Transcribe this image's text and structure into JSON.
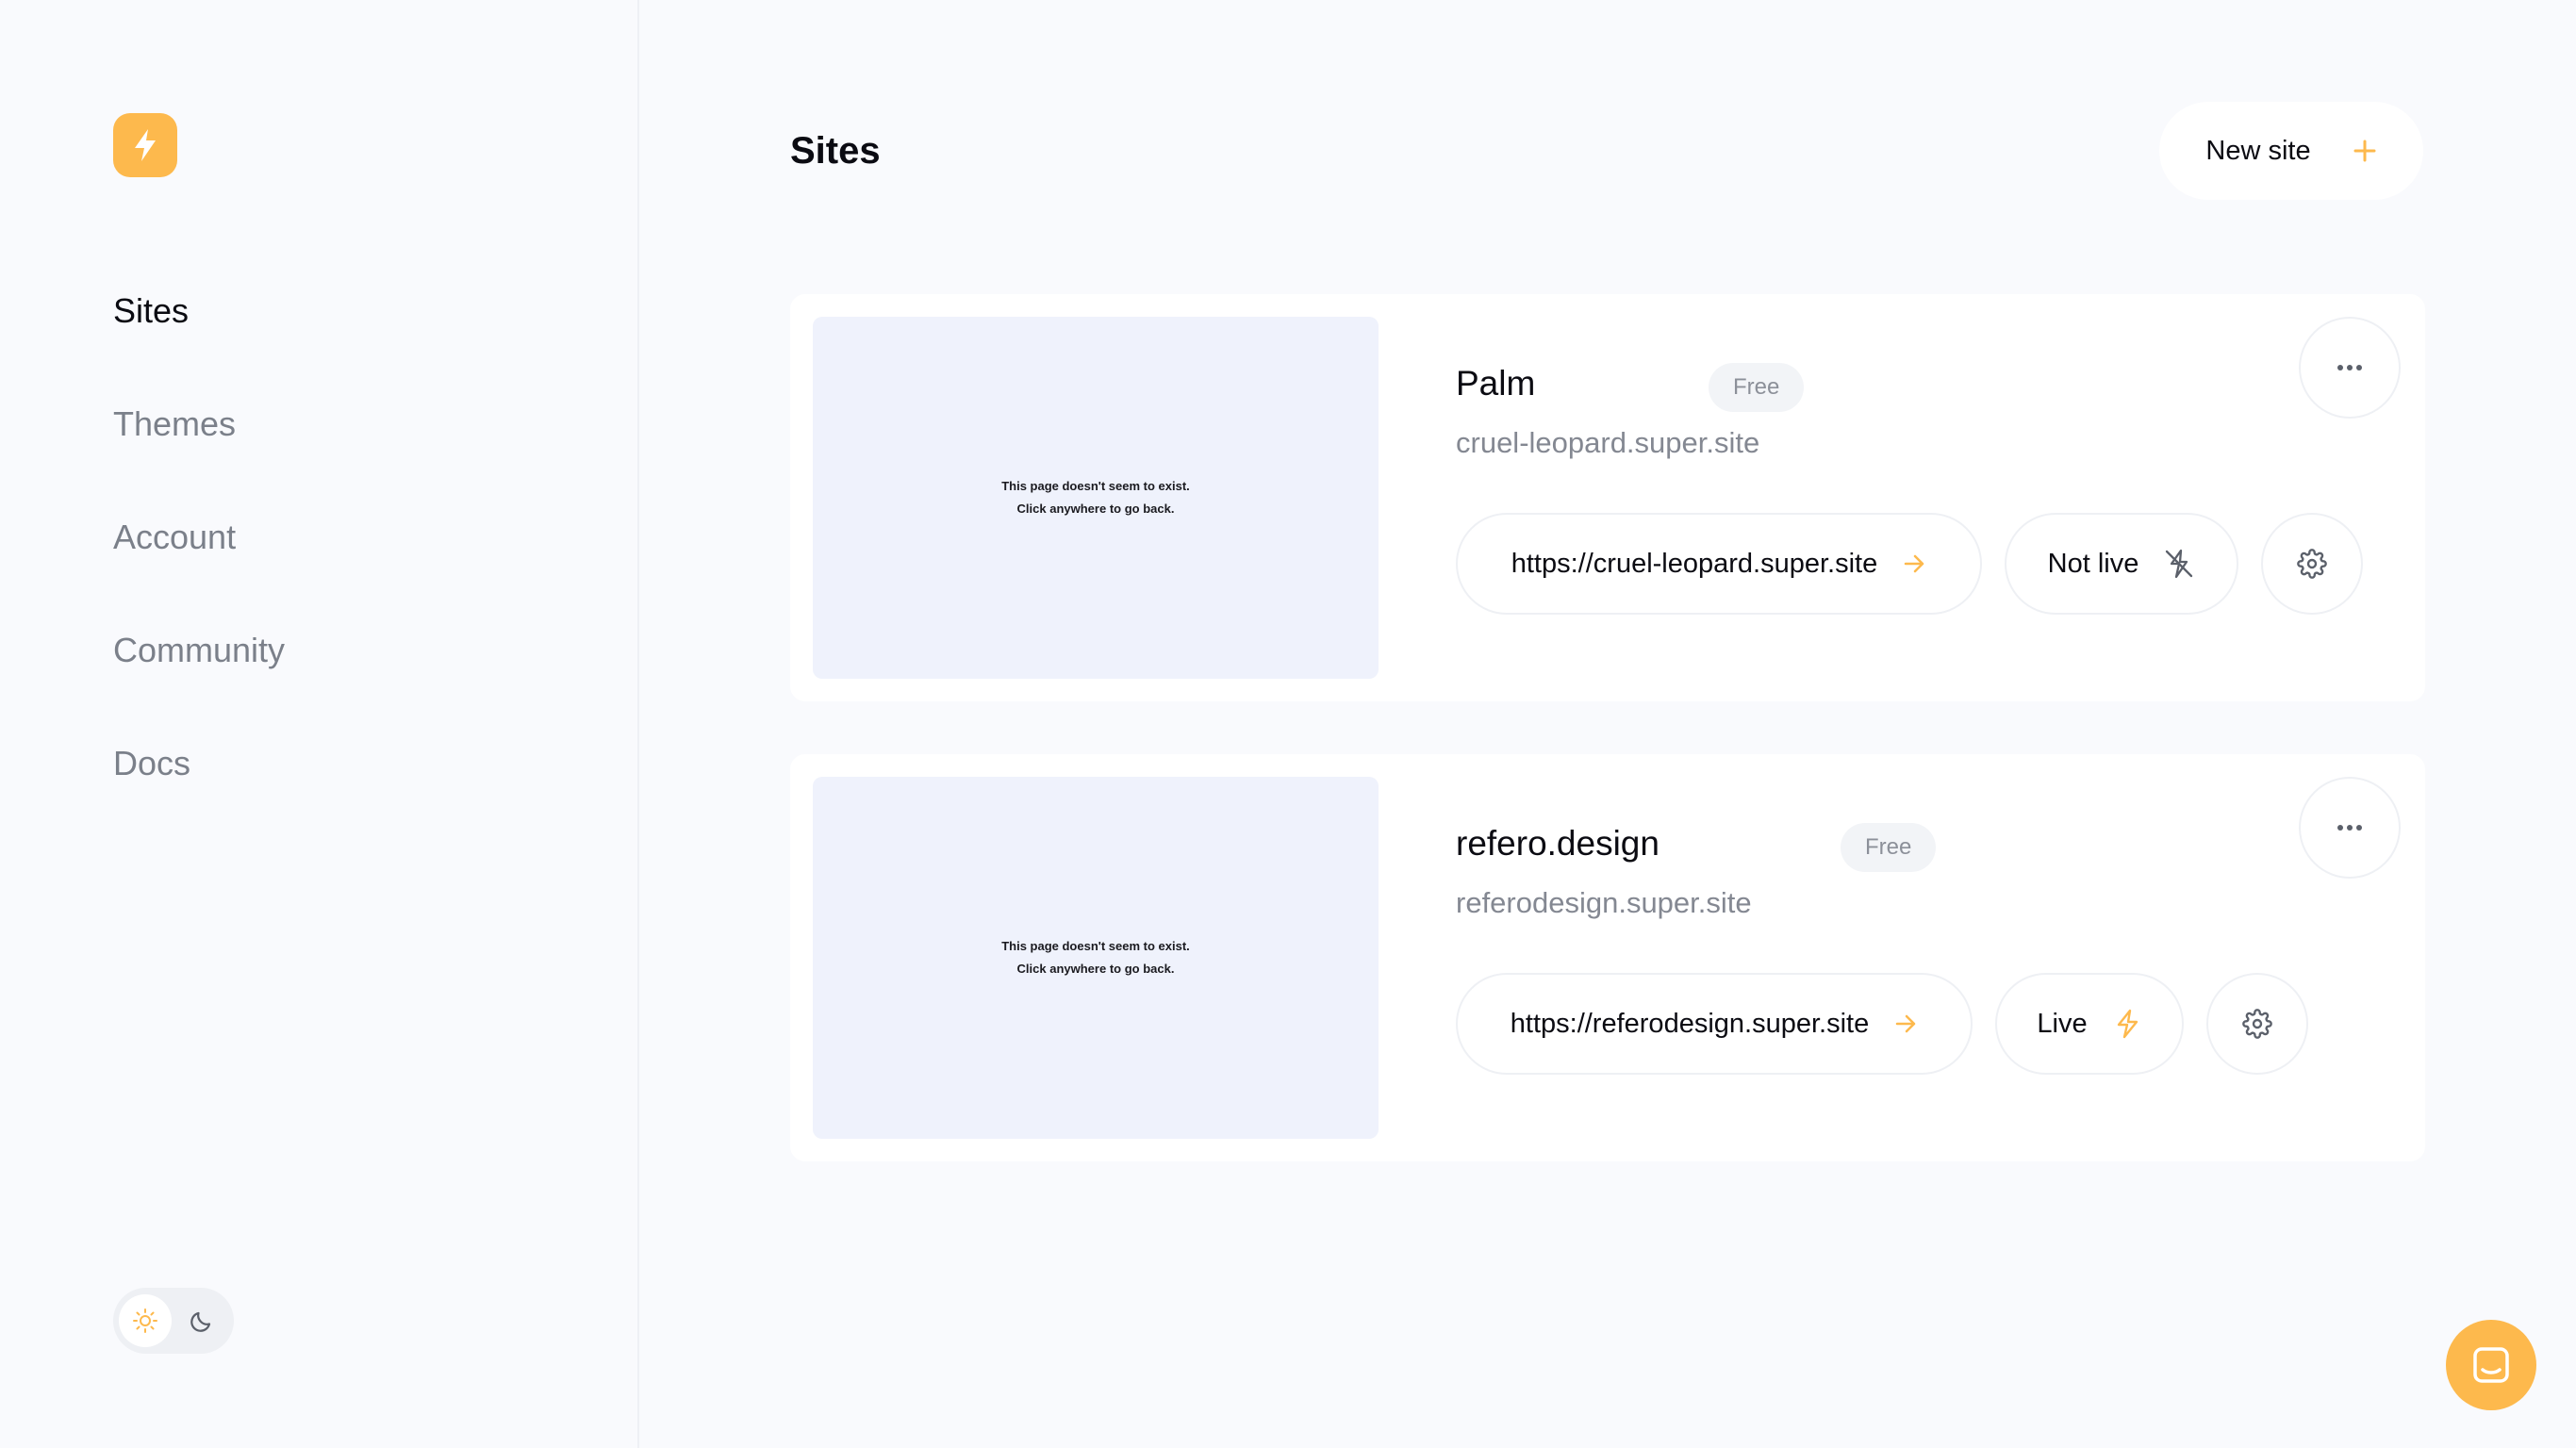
{
  "sidebar": {
    "nav": [
      {
        "label": "Sites",
        "active": true
      },
      {
        "label": "Themes",
        "active": false
      },
      {
        "label": "Account",
        "active": false
      },
      {
        "label": "Community",
        "active": false
      },
      {
        "label": "Docs",
        "active": false
      }
    ],
    "theme_toggle": {
      "selected": "light",
      "options": [
        "sun-icon",
        "moon-icon"
      ]
    }
  },
  "header": {
    "title": "Sites",
    "new_site_label": "New site"
  },
  "sites": [
    {
      "name": "Palm",
      "badge": "Free",
      "subdomain": "cruel-leopard.super.site",
      "url": "https://cruel-leopard.super.site",
      "status": "Not live",
      "status_icon": "bolt-off-icon",
      "preview_line1": "This page doesn't seem to exist.",
      "preview_line2": "Click anywhere to go back."
    },
    {
      "name": "refero.design",
      "badge": "Free",
      "subdomain": "referodesign.super.site",
      "url": "https://referodesign.super.site",
      "status": "Live",
      "status_icon": "bolt-icon",
      "preview_line1": "This page doesn't seem to exist.",
      "preview_line2": "Click anywhere to go back."
    }
  ],
  "colors": {
    "accent": "#fdb94d",
    "background": "#f9fafd",
    "card": "#ffffff",
    "muted_text": "#7b808a",
    "preview_bg": "#eff2fc"
  }
}
